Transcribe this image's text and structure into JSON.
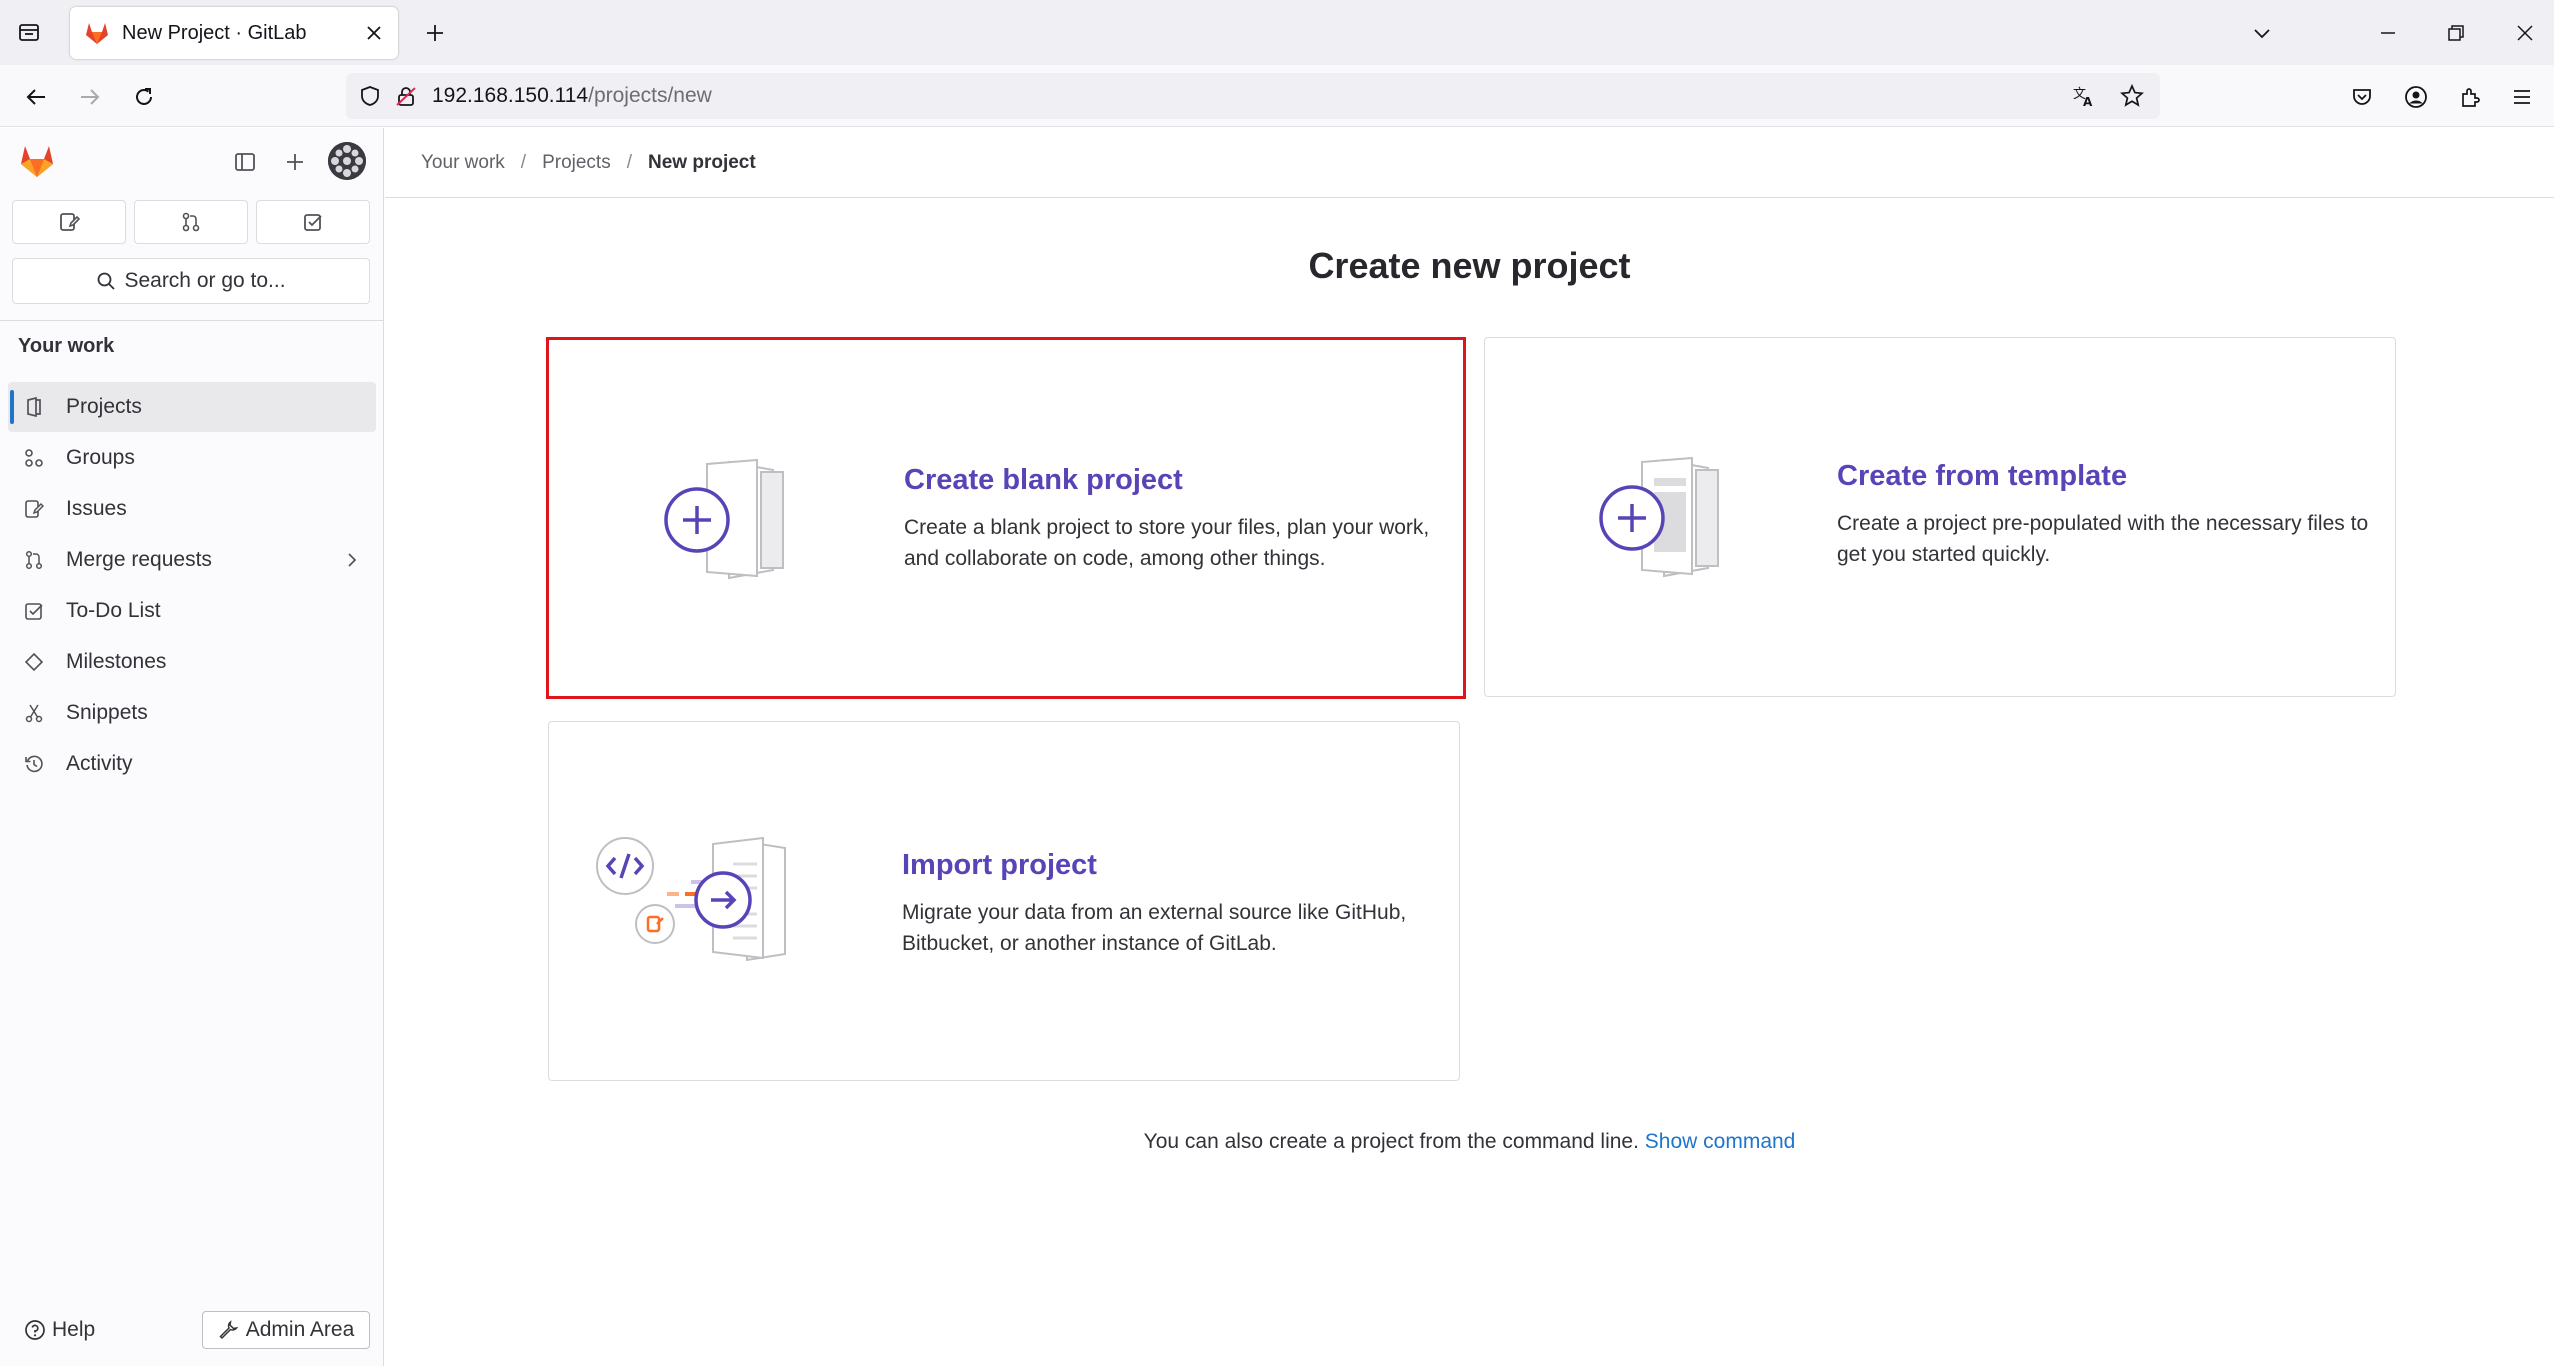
{
  "browser": {
    "tab_title": "New Project · GitLab",
    "url_host": "192.168.150.114",
    "url_path": "/projects/new"
  },
  "sidebar": {
    "search_label": "Search or go to...",
    "section_title": "Your work",
    "items": [
      {
        "label": "Projects",
        "icon": "project-icon",
        "active": true
      },
      {
        "label": "Groups",
        "icon": "group-icon"
      },
      {
        "label": "Issues",
        "icon": "issues-icon"
      },
      {
        "label": "Merge requests",
        "icon": "merge-request-icon",
        "has_submenu": true
      },
      {
        "label": "To-Do List",
        "icon": "todo-icon"
      },
      {
        "label": "Milestones",
        "icon": "milestone-icon"
      },
      {
        "label": "Snippets",
        "icon": "snippet-icon"
      },
      {
        "label": "Activity",
        "icon": "history-icon"
      }
    ],
    "help_label": "Help",
    "admin_label": "Admin Area"
  },
  "breadcrumbs": [
    "Your work",
    "Projects",
    "New project"
  ],
  "page_title": "Create new project",
  "cards": {
    "blank": {
      "title": "Create blank project",
      "description": "Create a blank project to store your files, plan your work, and collaborate on code, among other things."
    },
    "template": {
      "title": "Create from template",
      "description": "Create a project pre-populated with the necessary files to get you started quickly."
    },
    "import": {
      "title": "Import project",
      "description": "Migrate your data from an external source like GitHub, Bitbucket, or another instance of GitLab."
    }
  },
  "cli": {
    "text": "You can also create a project from the command line.",
    "link": "Show command"
  },
  "colors": {
    "accent_purple": "#5943b6",
    "link_blue": "#1f75cb",
    "selection_red": "#e0151b",
    "gitlab_orange": "#fc6d26"
  }
}
